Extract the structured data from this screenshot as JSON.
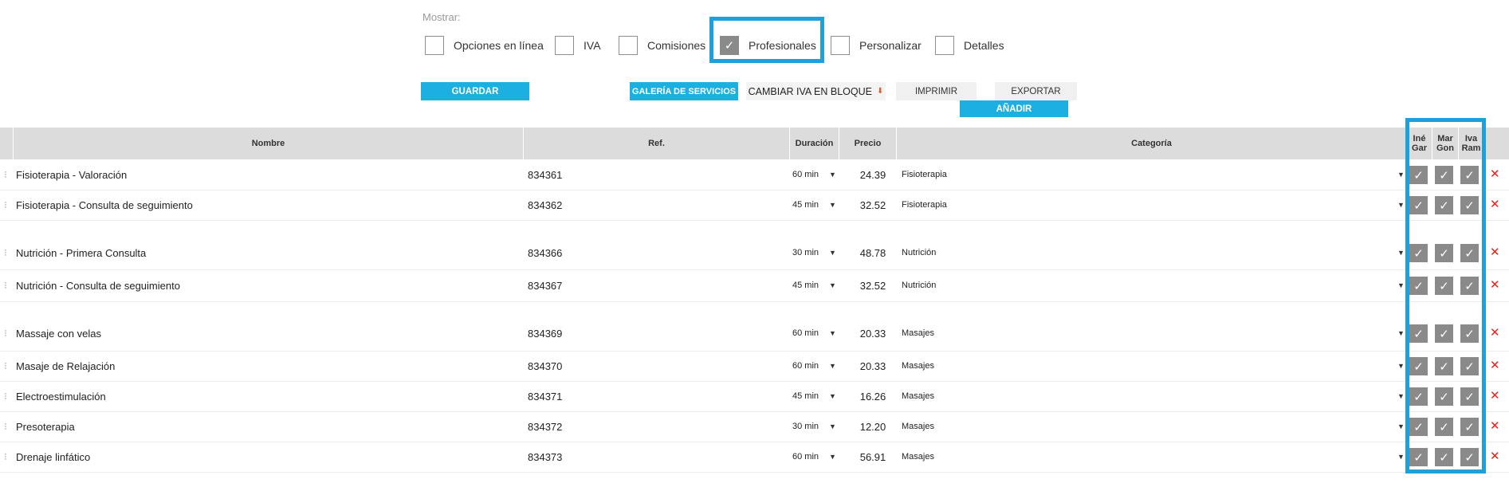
{
  "mostrar": {
    "label": "Mostrar:",
    "options": [
      {
        "label": "Opciones en línea",
        "checked": false
      },
      {
        "label": "IVA",
        "checked": false
      },
      {
        "label": "Comisiones",
        "checked": false
      },
      {
        "label": "Profesionales",
        "checked": true
      },
      {
        "label": "Personalizar",
        "checked": false
      },
      {
        "label": "Detalles",
        "checked": false
      }
    ]
  },
  "toolbar": {
    "guardar": "GUARDAR",
    "galeria": "GALERÍA DE SERVICIOS",
    "cambiar_iva": "CAMBIAR IVA EN BLOQUE",
    "imprimir": "IMPRIMIR",
    "exportar": "EXPORTAR",
    "anadir": "AÑADIR"
  },
  "table": {
    "headers": {
      "nombre": "Nombre",
      "ref": "Ref.",
      "duracion": "Duración",
      "precio": "Precio",
      "categoria": "Categoría"
    },
    "professionals": [
      "Iné Gar",
      "Mar Gon",
      "Iva Ram"
    ],
    "rows": [
      {
        "name": "Fisioterapia - Valoración",
        "ref": "834361",
        "duration": "60 min",
        "price": "24.39",
        "category": "Fisioterapia"
      },
      {
        "name": "Fisioterapia - Consulta de seguimiento",
        "ref": "834362",
        "duration": "45 min",
        "price": "32.52",
        "category": "Fisioterapia"
      },
      {
        "name": "Nutrición - Primera Consulta",
        "ref": "834366",
        "duration": "30 min",
        "price": "48.78",
        "category": "Nutrición"
      },
      {
        "name": "Nutrición - Consulta de seguimiento",
        "ref": "834367",
        "duration": "45 min",
        "price": "32.52",
        "category": "Nutrición"
      },
      {
        "name": "Massaje con velas",
        "ref": "834369",
        "duration": "60 min",
        "price": "20.33",
        "category": "Masajes"
      },
      {
        "name": "Masaje de Relajación",
        "ref": "834370",
        "duration": "60 min",
        "price": "20.33",
        "category": "Masajes"
      },
      {
        "name": "Electroestimulación",
        "ref": "834371",
        "duration": "45 min",
        "price": "16.26",
        "category": "Masajes"
      },
      {
        "name": "Presoterapia",
        "ref": "834372",
        "duration": "30 min",
        "price": "12.20",
        "category": "Masajes"
      },
      {
        "name": "Drenaje linfático",
        "ref": "834373",
        "duration": "60 min",
        "price": "56.91",
        "category": "Masajes"
      }
    ]
  },
  "colors": {
    "accent": "#1bb0e0",
    "highlight": "#1ea0dc",
    "delete": "#e8231d",
    "checkbox": "#8a8a8a"
  }
}
